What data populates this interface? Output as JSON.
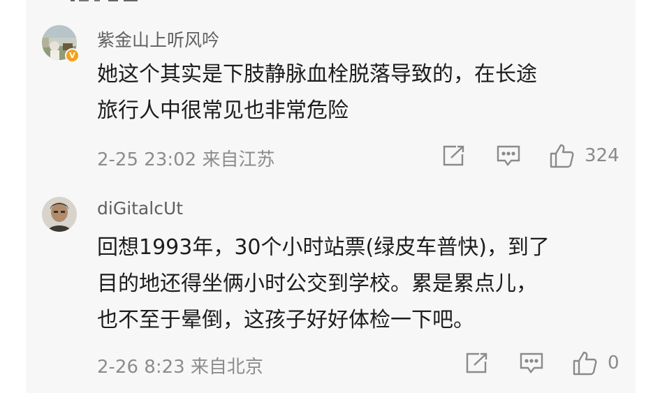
{
  "comments": [
    {
      "username": "紫金山上听风吟",
      "verified_badge": "V",
      "text": "她这个其实是下肢静脉血栓脱落导致的，在长途\n旅行人中很常见也非常危险",
      "timestamp": "2-25 23:02 来自江苏",
      "likes": "324"
    },
    {
      "username": "diGitalcUt",
      "text": "回想1993年，30个小时站票(绿皮车普快)，到了\n目的地还得坐俩小时公交到学校。累是累点儿，\n也不至于晕倒，这孩子好好体检一下吧。",
      "timestamp": "2-26 8:23 来自北京",
      "likes": "0"
    }
  ],
  "icons": {
    "share": "share-icon",
    "comment": "comment-icon",
    "like": "thumbs-up-icon"
  },
  "colors": {
    "panel_bg": "#f7f7f7",
    "username": "#5f5f5f",
    "text": "#1d1d1d",
    "meta": "#8c8c8c",
    "badge": "#f3a21b"
  }
}
